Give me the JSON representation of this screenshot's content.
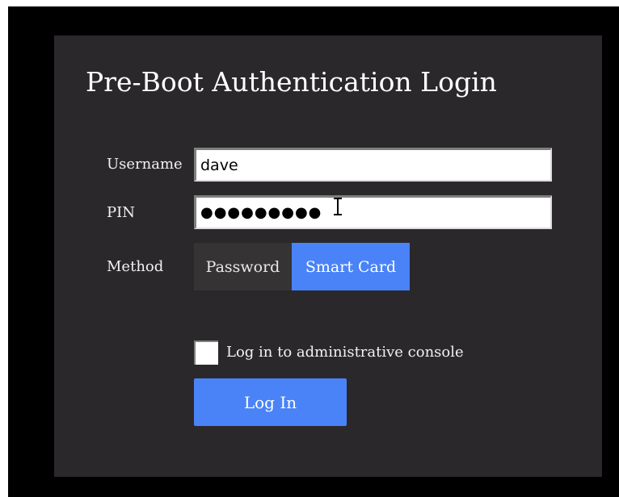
{
  "login": {
    "title": "Pre-Boot Authentication Login",
    "username_label": "Username",
    "username_value": "dave",
    "pin_label": "PIN",
    "pin_value": "●●●●●●●●●",
    "method_label": "Method",
    "method_options": [
      "Password",
      "Smart Card"
    ],
    "method_selected": "Smart Card",
    "admin_console_label": "Log in to administrative console",
    "admin_console_checked": false,
    "login_button_label": "Log In"
  },
  "colors": {
    "dialog_background": "#2b282b",
    "screen_background": "#000000",
    "accent": "#4a83f7",
    "unselected_segment": "#363335"
  },
  "icons": {
    "text_cursor": "i-beam-cursor-icon"
  }
}
